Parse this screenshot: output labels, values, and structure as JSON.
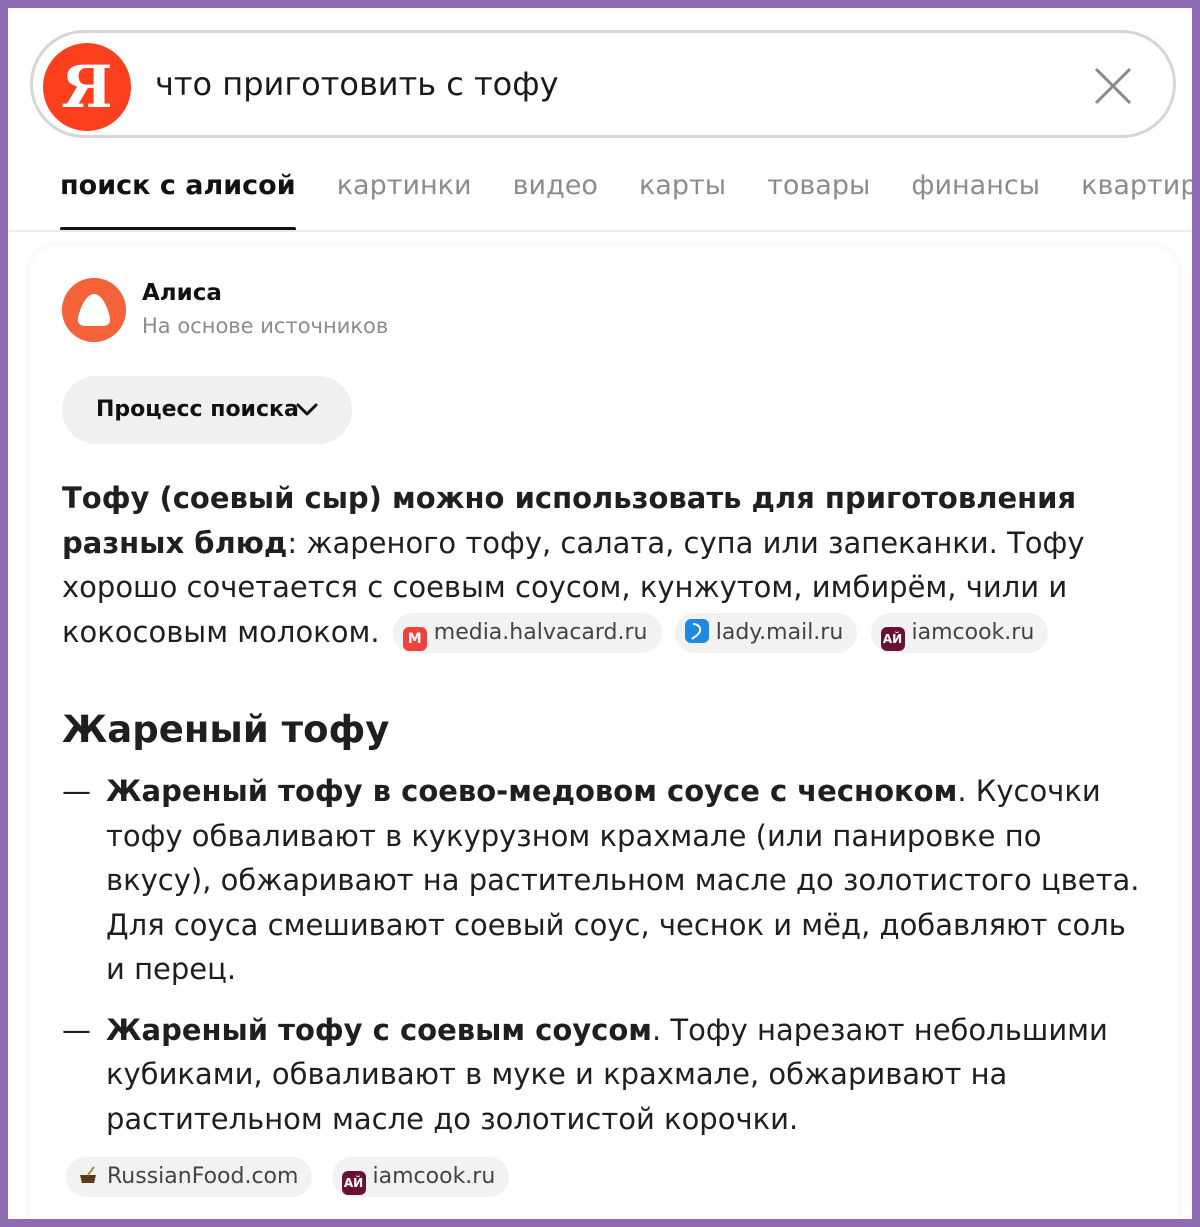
{
  "search": {
    "logo": "Я",
    "query": "что приготовить с тофу"
  },
  "tabs": [
    {
      "label": "поиск с алисой",
      "active": true
    },
    {
      "label": "картинки"
    },
    {
      "label": "видео"
    },
    {
      "label": "карты"
    },
    {
      "label": "товары"
    },
    {
      "label": "финансы"
    },
    {
      "label": "квартиры"
    }
  ],
  "answer": {
    "author": "Алиса",
    "subtitle": "На основе источников",
    "process_label": "Процесс поиска",
    "intro_bold": "Тофу (соевый сыр) можно использовать для приготовления разных блюд",
    "intro_rest": ": жареного тофу, салата, супа или запеканки. Тофу хорошо сочетается с соевым соусом, кунжутом, имбирём, чили и кокосовым молоком.",
    "intro_sources": [
      {
        "icon_text": "M",
        "icon_color": "#f0413a",
        "label": "media.halvacard.ru"
      },
      {
        "icon_text": "",
        "icon_color": "#1e88e5",
        "label": "lady.mail.ru"
      },
      {
        "icon_text": "АЙ",
        "icon_color": "#6b1035",
        "label": "iamcook.ru"
      }
    ],
    "section_title": "Жареный тофу",
    "items": [
      {
        "dash": "—",
        "title": "Жареный тофу в соево-медовом соусе с чесноком",
        "text": ". Кусочки тофу обваливают в кукурузном крахмале (или панировке по вкусу), обжаривают на растительном масле до золотистого цвета. Для соуса смешивают соевый соус, чеснок и мёд, добавляют соль и перец."
      },
      {
        "dash": "—",
        "title": "Жареный тофу с соевым соусом",
        "text": ". Тофу нарезают небольшими кубиками, обваливают в муке и крахмале, обжаривают на растительном масле до золотистой корочки."
      }
    ],
    "section_sources": [
      {
        "icon_text": "",
        "icon_color": "#f2f2f2",
        "label": "RussianFood.com"
      },
      {
        "icon_text": "АЙ",
        "icon_color": "#6b1035",
        "label": "iamcook.ru"
      }
    ]
  },
  "colors": {
    "brand": "#fc3f1d",
    "alice": "#f4623a",
    "frame": "#8e6bb3"
  }
}
